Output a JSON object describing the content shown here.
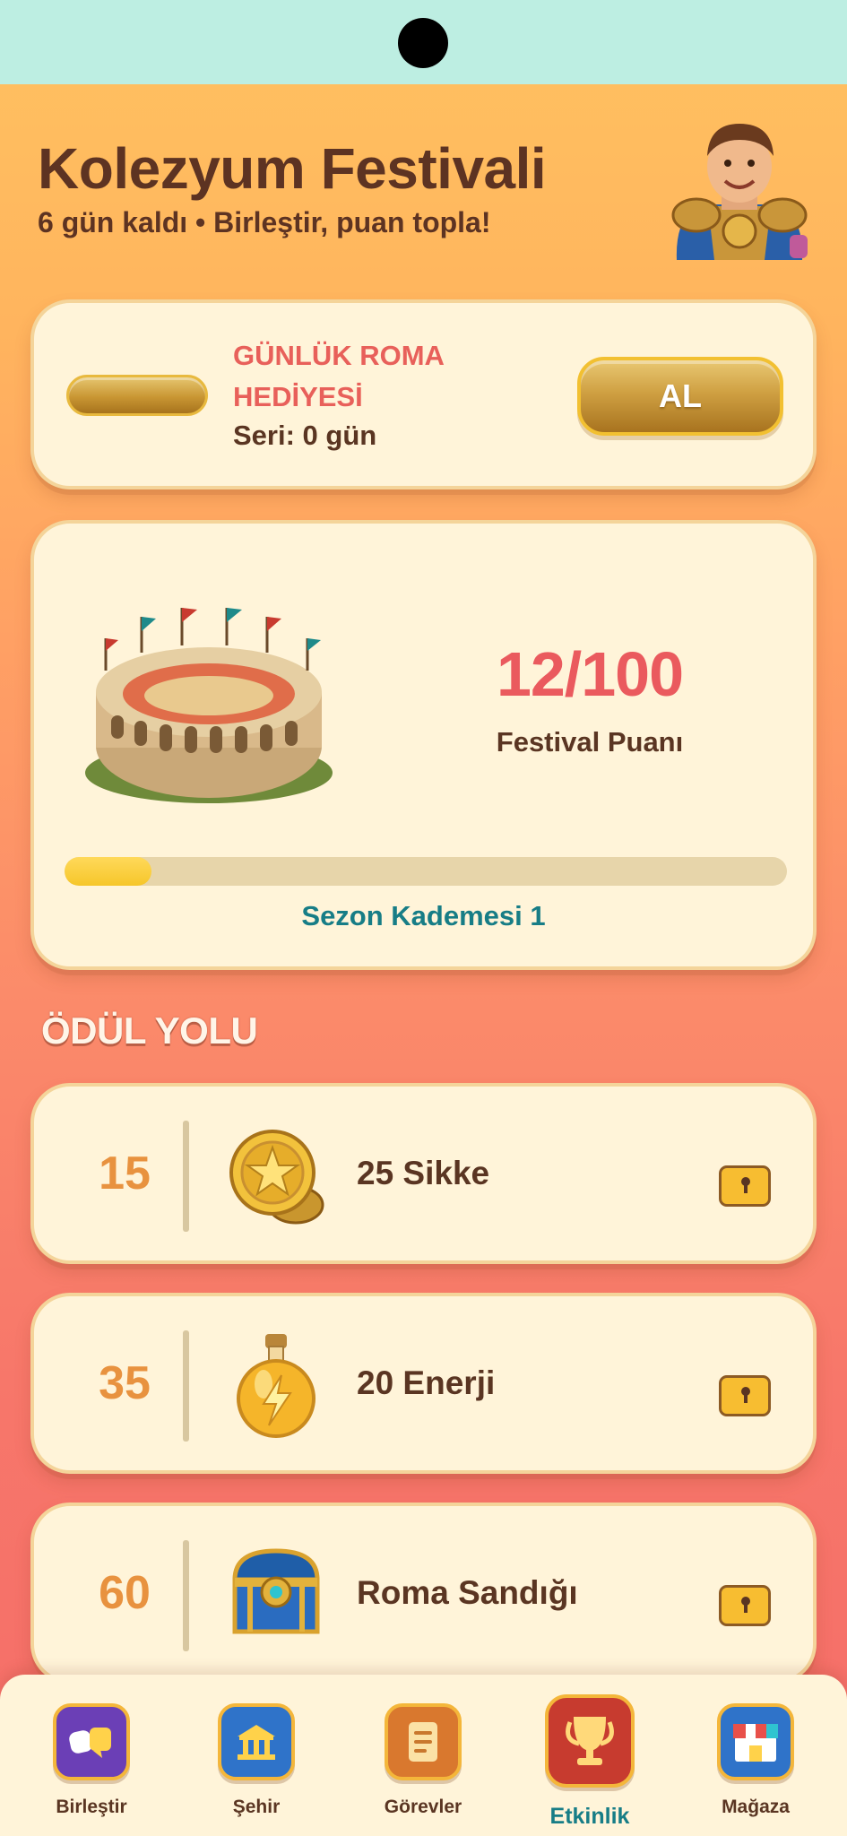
{
  "header": {
    "title": "Kolezyum Festivali",
    "subtitle": "6 gün kaldı • Birleştir, puan topla!"
  },
  "daily_gift": {
    "title": "GÜNLÜK ROMA HEDİYESİ",
    "streak": "Seri: 0 gün",
    "claim_label": "AL"
  },
  "festival": {
    "score": "12/100",
    "score_label": "Festival Puanı",
    "progress": 0.12,
    "season_label": "Sezon Kademesi 1"
  },
  "reward_path": {
    "title": "ÖDÜL YOLU",
    "items": [
      {
        "points": "15",
        "name": "25 Sikke",
        "icon": "gold-coins-icon",
        "locked": true
      },
      {
        "points": "35",
        "name": "20 Enerji",
        "icon": "energy-potion-icon",
        "locked": true
      },
      {
        "points": "60",
        "name": "Roma Sandığı",
        "icon": "treasure-chest-icon",
        "locked": true
      }
    ]
  },
  "nav": {
    "items": [
      {
        "label": "Birleştir",
        "icon": "merge-icon",
        "color": "#6b3fb6"
      },
      {
        "label": "Şehir",
        "icon": "city-hall-icon",
        "color": "#2f73c9"
      },
      {
        "label": "Görevler",
        "icon": "tasks-scroll-icon",
        "color": "#d9782e"
      },
      {
        "label": "Etkinlik",
        "icon": "trophy-icon",
        "color": "#c73b2f",
        "active": true
      },
      {
        "label": "Mağaza",
        "icon": "shop-icon",
        "color": "#2f73c9"
      }
    ]
  },
  "colors": {
    "accent_red": "#ea5a5e",
    "accent_teal": "#177d86",
    "card_bg": "#fff4d9",
    "text_brown": "#5a3522"
  }
}
